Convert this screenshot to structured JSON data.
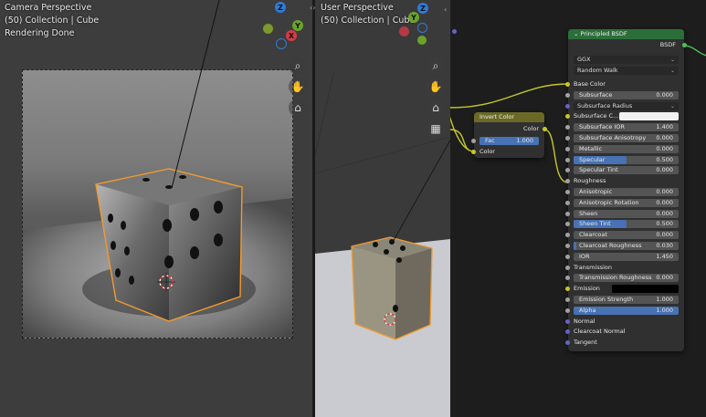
{
  "left_viewport": {
    "line1": "Camera Perspective",
    "line2": "(50) Collection | Cube",
    "line3": "Rendering Done"
  },
  "mid_viewport": {
    "line1": "User Perspective",
    "line2": "(50) Collection | Cube"
  },
  "gizmo": {
    "x": "X",
    "y": "Y",
    "z": "Z"
  },
  "invert_node": {
    "title": "Invert Color",
    "out_color": "Color",
    "fac_label": "Fac",
    "fac_value": "1.000",
    "in_color": "Color"
  },
  "bsdf_node": {
    "title": "Principled BSDF",
    "output": "BSDF",
    "distribution": "GGX",
    "subsurface_method": "Random Walk",
    "rows": [
      {
        "label": "Base Color",
        "value": "",
        "kind": "plain",
        "sock": "#c7c729"
      },
      {
        "label": "Subsurface",
        "value": "0.000",
        "kind": "field",
        "sock": "#a1a1a1",
        "fill": 0
      },
      {
        "label": "Subsurface Radius",
        "value": "",
        "kind": "dropdown",
        "sock": "#6363c7"
      },
      {
        "label": "Subsurface C...",
        "value": "",
        "kind": "color",
        "sock": "#c7c729"
      },
      {
        "label": "Subsurface IOR",
        "value": "1.400",
        "kind": "field",
        "sock": "#a1a1a1",
        "fill": 0
      },
      {
        "label": "Subsurface Anisotropy",
        "value": "0.000",
        "kind": "field",
        "sock": "#a1a1a1",
        "fill": 0
      },
      {
        "label": "Metallic",
        "value": "0.000",
        "kind": "field",
        "sock": "#a1a1a1",
        "fill": 0
      },
      {
        "label": "Specular",
        "value": "0.500",
        "kind": "field",
        "sock": "#a1a1a1",
        "fill": 0.5
      },
      {
        "label": "Specular Tint",
        "value": "0.000",
        "kind": "field",
        "sock": "#a1a1a1",
        "fill": 0
      },
      {
        "label": "Roughness",
        "value": "",
        "kind": "plain",
        "sock": "#a1a1a1"
      },
      {
        "label": "Anisotropic",
        "value": "0.000",
        "kind": "field",
        "sock": "#a1a1a1",
        "fill": 0
      },
      {
        "label": "Anisotropic Rotation",
        "value": "0.000",
        "kind": "field",
        "sock": "#a1a1a1",
        "fill": 0
      },
      {
        "label": "Sheen",
        "value": "0.000",
        "kind": "field",
        "sock": "#a1a1a1",
        "fill": 0
      },
      {
        "label": "Sheen Tint",
        "value": "0.500",
        "kind": "field",
        "sock": "#a1a1a1",
        "fill": 0.5
      },
      {
        "label": "Clearcoat",
        "value": "0.000",
        "kind": "field",
        "sock": "#a1a1a1",
        "fill": 0
      },
      {
        "label": "Clearcoat Roughness",
        "value": "0.030",
        "kind": "field",
        "sock": "#a1a1a1",
        "fill": 0.03
      },
      {
        "label": "IOR",
        "value": "1.450",
        "kind": "field",
        "sock": "#a1a1a1",
        "fill": 0
      },
      {
        "label": "Transmission",
        "value": "",
        "kind": "plain",
        "sock": "#a1a1a1"
      },
      {
        "label": "Transmission Roughness",
        "value": "0.000",
        "kind": "field",
        "sock": "#a1a1a1",
        "fill": 0
      },
      {
        "label": "Emission",
        "value": "",
        "kind": "emission",
        "sock": "#c7c729"
      },
      {
        "label": "Emission Strength",
        "value": "1.000",
        "kind": "field",
        "sock": "#a1a1a1",
        "fill": 0
      },
      {
        "label": "Alpha",
        "value": "1.000",
        "kind": "field",
        "sock": "#a1a1a1",
        "fill": 1
      },
      {
        "label": "Normal",
        "value": "",
        "kind": "plain",
        "sock": "#6363c7"
      },
      {
        "label": "Clearcoat Normal",
        "value": "",
        "kind": "plain",
        "sock": "#6363c7"
      },
      {
        "label": "Tangent",
        "value": "",
        "kind": "plain",
        "sock": "#6363c7"
      }
    ]
  },
  "colors": {
    "selection_orange": "#f29a2e",
    "bsdf_header": "#2c6e3a",
    "invert_header": "#6a6a26",
    "link_yellow": "#c7c729",
    "accent_blue": "#4772b3"
  }
}
